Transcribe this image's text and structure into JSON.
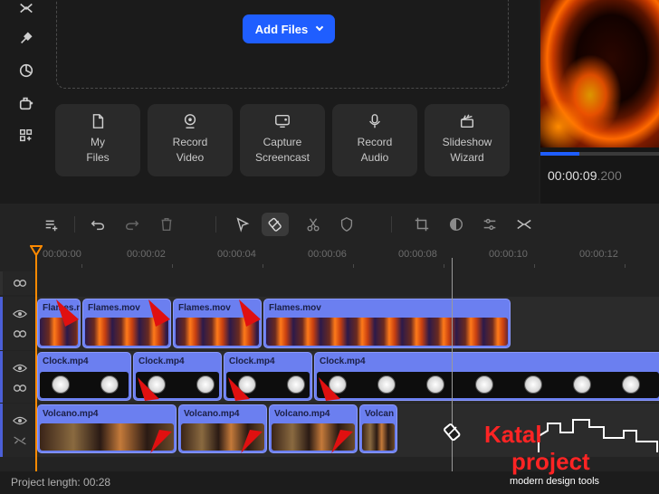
{
  "sidebar": {
    "icons": [
      "transitions-icon",
      "effects-icon",
      "stickers-icon",
      "export-icon",
      "more-tools-icon"
    ]
  },
  "media": {
    "add_files_label": "Add Files",
    "tiles": [
      {
        "line1": "My",
        "line2": "Files",
        "icon": "file-icon"
      },
      {
        "line1": "Record",
        "line2": "Video",
        "icon": "webcam-icon"
      },
      {
        "line1": "Capture",
        "line2": "Screencast",
        "icon": "screen-icon"
      },
      {
        "line1": "Record",
        "line2": "Audio",
        "icon": "microphone-icon"
      },
      {
        "line1": "Slideshow",
        "line2": "Wizard",
        "icon": "clapperboard-icon"
      }
    ]
  },
  "preview": {
    "timecode_main": "00:00:09",
    "timecode_ms": ".200",
    "progress": 0.33
  },
  "toolbar": {
    "icons": [
      "add-track-icon",
      "undo-icon",
      "redo-icon",
      "delete-icon",
      "select-tool-icon",
      "blade-tool-icon",
      "cut-icon",
      "shield-icon",
      "crop-icon",
      "color-icon",
      "adjust-icon",
      "transition-icon"
    ]
  },
  "ruler": {
    "labels": [
      "00:00:00",
      "00:00:02",
      "00:00:04",
      "00:00:06",
      "00:00:08",
      "00:00:10",
      "00:00:12"
    ]
  },
  "tracks": {
    "flames": [
      {
        "title": "Flames.mov"
      },
      {
        "title": "Flames.mov"
      },
      {
        "title": "Flames.mov"
      },
      {
        "title": "Flames.mov"
      }
    ],
    "clock": [
      {
        "title": "Clock.mp4"
      },
      {
        "title": "Clock.mp4"
      },
      {
        "title": "Clock.mp4"
      },
      {
        "title": "Clock.mp4"
      }
    ],
    "volcano": [
      {
        "title": "Volcano.mp4"
      },
      {
        "title": "Volcano.mp4"
      },
      {
        "title": "Volcano.mp4"
      },
      {
        "title": "Volcan"
      }
    ]
  },
  "status": {
    "project_length": "Project length: 00:28"
  },
  "logo": {
    "line1": "Katal",
    "line2": "project",
    "tagline": "modern design tools"
  },
  "colors": {
    "accent": "#1f5eff",
    "clip": "#6b7ff0",
    "playhead": "#ff8a00",
    "annotation": "#e01010",
    "logo": "#ff2424"
  }
}
